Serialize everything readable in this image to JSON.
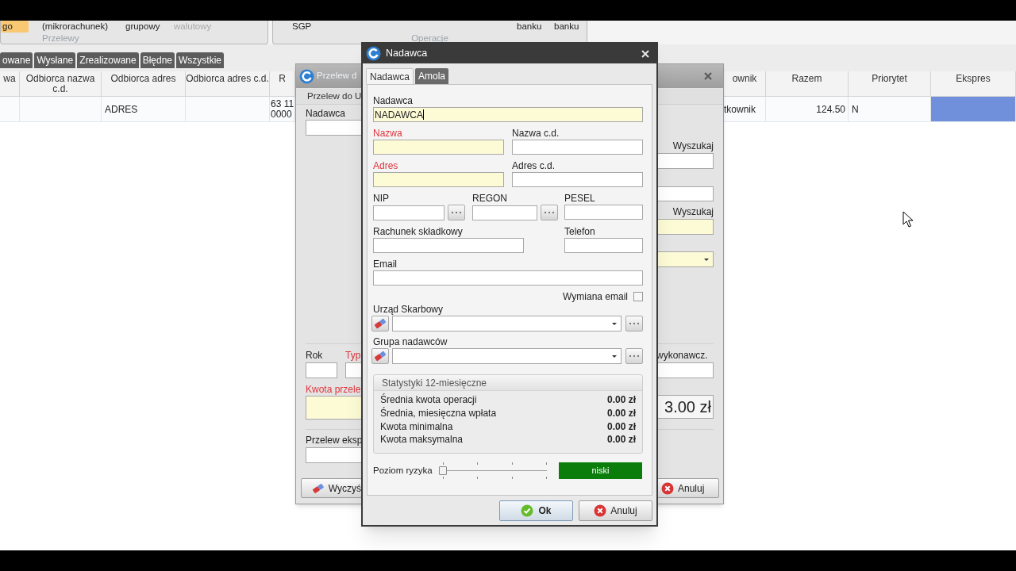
{
  "ribbon": {
    "groups": [
      {
        "label": "Przelewy",
        "items": [
          {
            "text": "go",
            "selected": true,
            "disabled": false
          },
          {
            "text": "(mikrorachunek)",
            "selected": false,
            "disabled": false
          },
          {
            "text": "grupowy",
            "selected": false,
            "disabled": false
          },
          {
            "text": "walutowy",
            "selected": false,
            "disabled": true
          }
        ]
      },
      {
        "label": "Operacje",
        "items": [
          {
            "text": "SGP",
            "selected": false,
            "disabled": false
          },
          {
            "text": "banku",
            "selected": false,
            "disabled": false
          },
          {
            "text": "banku",
            "selected": false,
            "disabled": false
          }
        ]
      }
    ]
  },
  "status_tabs": [
    "owane",
    "Wysłane",
    "Zrealizowane",
    "Błędne",
    "Wszystkie"
  ],
  "table": {
    "columns": [
      "wa",
      "Odbiorca nazwa c.d.",
      "Odbiorca adres",
      "Odbiorca adres c.d.",
      "R",
      "ownik",
      "Razem",
      "Priorytet",
      "Ekspres"
    ],
    "rows": [
      {
        "cells": [
          {
            "selected": false
          },
          {
            "selected": false
          },
          {
            "text": "ADRES",
            "selected": false
          },
          {
            "selected": false
          },
          {
            "text": "63 11\n0000",
            "selected": false
          },
          {
            "text": "tkownik",
            "selected": false
          },
          {
            "text": "124.50",
            "selected": false
          },
          {
            "text": "N",
            "selected": false
          },
          {
            "selected": true
          }
        ]
      }
    ]
  },
  "back_dialog": {
    "title": "Przelew d",
    "tab": "Przelew do U",
    "sender_label": {
      "text": "Nadawca",
      "required": false
    },
    "search_labels": [
      "Wyszukaj",
      "Wyszukaj"
    ],
    "year_label": {
      "text": "Rok",
      "required": false
    },
    "type_label": {
      "text": "Typ",
      "required": true
    },
    "executive_label": "wykonawcz.",
    "amount_label": {
      "text": "Kwota przele",
      "required": true
    },
    "amount_value": "3.00 zł",
    "express_label": "Przelew eksp",
    "clear_button": "Wyczyś",
    "cancel_button": "Anuluj"
  },
  "dialog": {
    "title": "Nadawca",
    "tabs": [
      {
        "label": "Nadawca",
        "selected": true
      },
      {
        "label": "Amola",
        "selected": false
      }
    ],
    "sender": {
      "label": "Nadawca",
      "value": "NADAWCA",
      "focused": true
    },
    "name": {
      "label": "Nazwa",
      "required": true
    },
    "name_cont": {
      "label": "Nazwa c.d.",
      "required": false
    },
    "address": {
      "label": "Adres",
      "required": true
    },
    "address_cont": {
      "label": "Adres c.d.",
      "required": false
    },
    "nip": {
      "label": "NIP"
    },
    "regon": {
      "label": "REGON"
    },
    "pesel": {
      "label": "PESEL"
    },
    "account": {
      "label": "Rachunek składkowy"
    },
    "phone": {
      "label": "Telefon"
    },
    "email": {
      "label": "Email"
    },
    "email_exchange": {
      "label": "Wymiana email",
      "checked": false
    },
    "tax_office": {
      "label": "Urząd Skarbowy"
    },
    "sender_group": {
      "label": "Grupa nadawców"
    },
    "stats": {
      "title": "Statystyki 12-miesięczne",
      "rows": [
        {
          "label": "Średnia kwota operacji",
          "value": "0.00 zł"
        },
        {
          "label": "Średnia, miesięczna wpłata",
          "value": "0.00 zł"
        },
        {
          "label": "Kwota minimalna",
          "value": "0.00 zł"
        },
        {
          "label": "Kwota maksymalna",
          "value": "0.00 zł"
        }
      ]
    },
    "risk": {
      "label": "Poziom ryzyka",
      "level": 0,
      "reading": "niski"
    },
    "buttons": {
      "ok": "Ok",
      "cancel": "Anuluj"
    }
  }
}
